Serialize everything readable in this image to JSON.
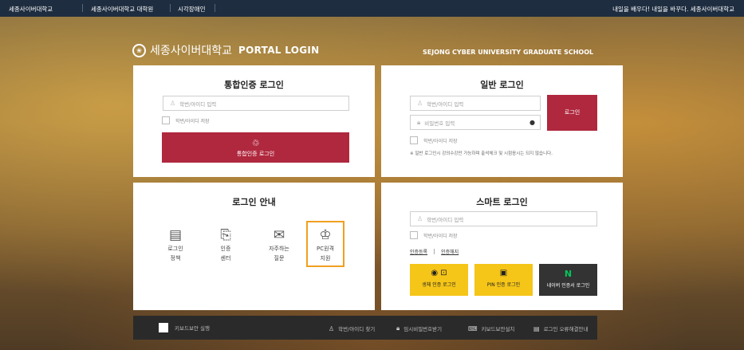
{
  "topbar": {
    "links": [
      "세종사이버대학교",
      "세종사이버대학교 대학원",
      "시각장애인"
    ],
    "slogan": "내일을 배우다! 내일을 바꾸다. 세종사이버대학교"
  },
  "brand": {
    "name_kr": "세종사이버대학교",
    "title": "PORTAL LOGIN",
    "grad_school": "SEJONG CYBER UNIVERSITY GRADUATE SCHOOL"
  },
  "integrated": {
    "title": "통합인증 로그인",
    "id_placeholder": "학번/아이디 입력",
    "save_label": "학번/아이디 저장",
    "button": "통합인증 로그인"
  },
  "general": {
    "title": "일반 로그인",
    "id_placeholder": "학번/아이디 입력",
    "pw_placeholder": "비밀번호 입력",
    "login_button": "로그인",
    "save_label": "학번/아이디 저장",
    "notice": "※ 일반 로그인시 강의수강만 가능하며 출석체크 및 시험응시는 되지 않습니다."
  },
  "guide": {
    "title": "로그인 안내",
    "items": [
      {
        "line1": "로그인",
        "line2": "정책"
      },
      {
        "line1": "인증",
        "line2": "센터"
      },
      {
        "line1": "자주하는",
        "line2": "질문"
      },
      {
        "line1": "PC원격",
        "line2": "지원"
      }
    ]
  },
  "smart": {
    "title": "스마트 로그인",
    "id_placeholder": "학번/아이디 입력",
    "save_label": "학번/아이디 저장",
    "register": "인증등록",
    "unregister": "인증해지",
    "bio": "생체 인증 로그인",
    "pin": "PIN 인증 로그인",
    "naver": "네이버 인증서 로그인",
    "naver_letter": "N"
  },
  "footer": {
    "keyboard": "키보드보안 실행",
    "find_id": "학번/아이디 찾기",
    "temp_pw": "임시비밀번호받기",
    "kb_install": "키보드보안설치",
    "error_guide": "로그인 오류해결안내"
  }
}
